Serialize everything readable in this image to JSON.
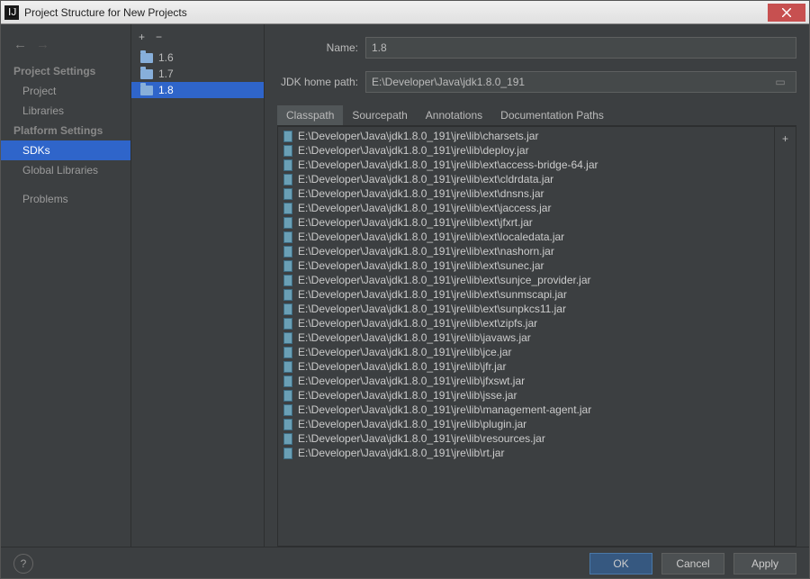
{
  "window": {
    "title": "Project Structure for New Projects"
  },
  "sidebar": {
    "headings": {
      "project": "Project Settings",
      "platform": "Platform Settings"
    },
    "items": {
      "project": "Project",
      "libraries": "Libraries",
      "sdks": "SDKs",
      "global_libs": "Global Libraries",
      "problems": "Problems"
    }
  },
  "sdk_list": [
    {
      "label": "1.6"
    },
    {
      "label": "1.7"
    },
    {
      "label": "1.8",
      "selected": true
    }
  ],
  "form": {
    "name_label": "Name:",
    "name_value": "1.8",
    "home_label": "JDK home path:",
    "home_value": "E:\\Developer\\Java\\jdk1.8.0_191"
  },
  "tabs": [
    {
      "label": "Classpath",
      "active": true
    },
    {
      "label": "Sourcepath"
    },
    {
      "label": "Annotations"
    },
    {
      "label": "Documentation Paths"
    }
  ],
  "classpath": [
    "E:\\Developer\\Java\\jdk1.8.0_191\\jre\\lib\\charsets.jar",
    "E:\\Developer\\Java\\jdk1.8.0_191\\jre\\lib\\deploy.jar",
    "E:\\Developer\\Java\\jdk1.8.0_191\\jre\\lib\\ext\\access-bridge-64.jar",
    "E:\\Developer\\Java\\jdk1.8.0_191\\jre\\lib\\ext\\cldrdata.jar",
    "E:\\Developer\\Java\\jdk1.8.0_191\\jre\\lib\\ext\\dnsns.jar",
    "E:\\Developer\\Java\\jdk1.8.0_191\\jre\\lib\\ext\\jaccess.jar",
    "E:\\Developer\\Java\\jdk1.8.0_191\\jre\\lib\\ext\\jfxrt.jar",
    "E:\\Developer\\Java\\jdk1.8.0_191\\jre\\lib\\ext\\localedata.jar",
    "E:\\Developer\\Java\\jdk1.8.0_191\\jre\\lib\\ext\\nashorn.jar",
    "E:\\Developer\\Java\\jdk1.8.0_191\\jre\\lib\\ext\\sunec.jar",
    "E:\\Developer\\Java\\jdk1.8.0_191\\jre\\lib\\ext\\sunjce_provider.jar",
    "E:\\Developer\\Java\\jdk1.8.0_191\\jre\\lib\\ext\\sunmscapi.jar",
    "E:\\Developer\\Java\\jdk1.8.0_191\\jre\\lib\\ext\\sunpkcs11.jar",
    "E:\\Developer\\Java\\jdk1.8.0_191\\jre\\lib\\ext\\zipfs.jar",
    "E:\\Developer\\Java\\jdk1.8.0_191\\jre\\lib\\javaws.jar",
    "E:\\Developer\\Java\\jdk1.8.0_191\\jre\\lib\\jce.jar",
    "E:\\Developer\\Java\\jdk1.8.0_191\\jre\\lib\\jfr.jar",
    "E:\\Developer\\Java\\jdk1.8.0_191\\jre\\lib\\jfxswt.jar",
    "E:\\Developer\\Java\\jdk1.8.0_191\\jre\\lib\\jsse.jar",
    "E:\\Developer\\Java\\jdk1.8.0_191\\jre\\lib\\management-agent.jar",
    "E:\\Developer\\Java\\jdk1.8.0_191\\jre\\lib\\plugin.jar",
    "E:\\Developer\\Java\\jdk1.8.0_191\\jre\\lib\\resources.jar",
    "E:\\Developer\\Java\\jdk1.8.0_191\\jre\\lib\\rt.jar"
  ],
  "buttons": {
    "ok": "OK",
    "cancel": "Cancel",
    "apply": "Apply"
  }
}
